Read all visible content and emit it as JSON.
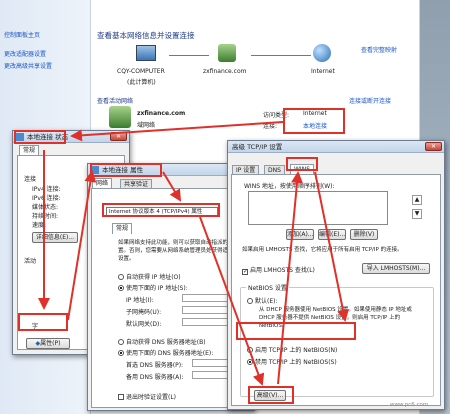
{
  "side_nav": {
    "top": "控制面板主页",
    "items": [
      "更改适配器设置",
      "更改高级共享设置"
    ]
  },
  "network_center": {
    "heading": "查看基本网络信息并设置连接",
    "view_full_map": "查看完整映射",
    "nodes": [
      {
        "name": "CQY-COMPUTER",
        "sub": "(此计算机)"
      },
      {
        "name": "zxfinance.com",
        "sub": ""
      },
      {
        "name": "Internet",
        "sub": ""
      }
    ],
    "active_label": "查看活动网络",
    "connect_disconnect": "连接或断开连接",
    "network_name": "zxfinance.com",
    "network_type": "域网络",
    "access_type_label": "访问类型:",
    "access_type_value": "Internet",
    "connections_label": "连接:",
    "connections_value": "本地连接"
  },
  "status_dialog": {
    "title": "本地连接 状态",
    "tab": "常规",
    "section": "连接",
    "rows": [
      "IPv4 连接:",
      "IPv6 连接:",
      "媒体状态:",
      "持续时间:",
      "速度:"
    ],
    "details_button": "详细信息(E)...",
    "activity": "活动",
    "sent_label": "字",
    "properties_button": "属性(P)"
  },
  "props_dialog": {
    "title": "本地连接 属性",
    "tabs": [
      "网络",
      "共享验证"
    ],
    "item_selected": "Internet 协议版本 4 (TCP/IPv4) 属性",
    "inner_tab": "常规",
    "desc": "如果网络支持此功能，则可以获取自动指派的 IP 设置。否则，您需要从网络系统管理员处获得适当的 IP 设置。",
    "auto_ip": "自动获得 IP 地址(O)",
    "manual_ip": "使用下面的 IP 地址(S):",
    "ip_addr": "IP 地址(I):",
    "subnet": "子网掩码(U):",
    "gateway": "默认网关(D):",
    "auto_dns": "自动获得 DNS 服务器地址(B)",
    "manual_dns": "使用下面的 DNS 服务器地址(E):",
    "pref_dns": "首选 DNS 服务器(P):",
    "alt_dns": "备用 DNS 服务器(A):",
    "validate": "退出时验证设置(L)",
    "advanced_button": "高级(V)..."
  },
  "advanced_dialog": {
    "title": "高级 TCP/IP 设置",
    "tabs": [
      "IP 设置",
      "DNS",
      "WINS"
    ],
    "wins_label": "WINS 地址，按使用顺序排列(W):",
    "add_button": "添加(A)...",
    "edit_button": "编辑(E)...",
    "remove_button": "删除(V)",
    "lmhosts_desc": "如果启用 LMHOSTS 查找，它将应用于所有启用 TCP/IP 的连接。",
    "lmhosts_check": "启用 LMHOSTS 查找(L)",
    "import_button": "导入 LMHOSTS(M)...",
    "netbios_label": "NetBIOS 设置",
    "nb_default": "默认(E):",
    "nb_default_desc": "从 DHCP 服务器使用 NetBIOS 设置。如果使用静态 IP 地址或 DHCP 服务器不提供 NetBIOS 设置，则启用 TCP/IP 上的 NetBIOS。",
    "nb_enable": "启用 TCP/IP 上的 NetBIOS(N)",
    "nb_disable": "禁用 TCP/IP 上的 NetBIOS(S)"
  },
  "watermark": "www.pc6.com",
  "colors": {
    "highlight": "#e0302a",
    "link": "#1a55c8"
  }
}
